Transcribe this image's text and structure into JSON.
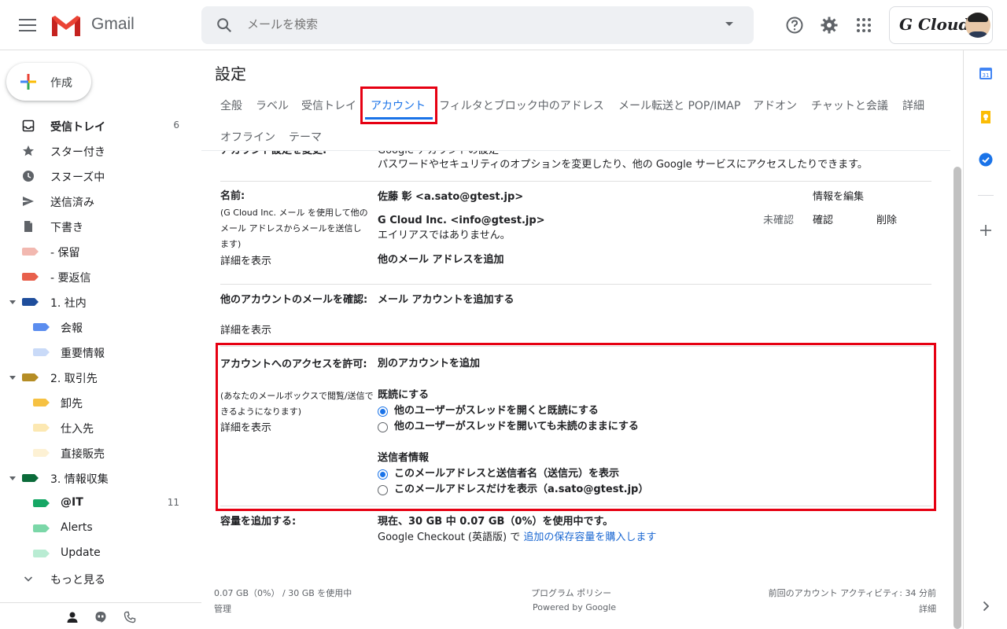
{
  "header": {
    "app_name": "Gmail",
    "search_placeholder": "メールを検索",
    "account_label": "G Cloud"
  },
  "sidebar": {
    "compose_label": "作成",
    "items": [
      {
        "label": "受信トレイ",
        "count": "6",
        "icon": "inbox-icon",
        "bold": true
      },
      {
        "label": "スター付き",
        "count": "",
        "icon": "star-icon"
      },
      {
        "label": "スヌーズ中",
        "count": "",
        "icon": "clock-icon"
      },
      {
        "label": "送信済み",
        "count": "",
        "icon": "send-icon"
      },
      {
        "label": "下書き",
        "count": "",
        "icon": "draft-icon"
      },
      {
        "label": "- 保留",
        "count": "",
        "icon": "label-icon",
        "color": "#f2b8b0"
      },
      {
        "label": "- 要返信",
        "count": "",
        "icon": "label-icon",
        "color": "#e8604c"
      },
      {
        "label": "1. 社内",
        "count": "",
        "icon": "label-icon",
        "color": "#1f4e9c"
      },
      {
        "label": "会報",
        "count": "",
        "icon": "label-icon",
        "color": "#5b8def"
      },
      {
        "label": "重要情報",
        "count": "",
        "icon": "label-icon",
        "color": "#c9daf8"
      },
      {
        "label": "2. 取引先",
        "count": "",
        "icon": "label-icon",
        "color": "#b58d25"
      },
      {
        "label": "卸先",
        "count": "",
        "icon": "label-icon",
        "color": "#f6c142"
      },
      {
        "label": "仕入先",
        "count": "",
        "icon": "label-icon",
        "color": "#fce8b2"
      },
      {
        "label": "直接販売",
        "count": "",
        "icon": "label-icon",
        "color": "#fdf1d4"
      },
      {
        "label": "3. 情報収集",
        "count": "",
        "icon": "label-icon",
        "color": "#0b6b3a"
      },
      {
        "label": "@IT",
        "count": "11",
        "icon": "label-icon",
        "color": "#16a765",
        "bold": true
      },
      {
        "label": "Alerts",
        "count": "",
        "icon": "label-icon",
        "color": "#7bd7a8"
      },
      {
        "label": "Update",
        "count": "",
        "icon": "label-icon",
        "color": "#b9ecd3"
      },
      {
        "label": "もっと見る",
        "count": "",
        "icon": "chevron-down-icon"
      }
    ]
  },
  "settings": {
    "title": "設定",
    "tabs_row1": [
      "全般",
      "ラベル",
      "受信トレイ",
      "アカウント",
      "フィルタとブロック中のアドレス",
      "メール転送と POP/IMAP",
      "アドオン",
      "チャットと会議",
      "詳細"
    ],
    "tabs_row2": [
      "オフライン",
      "テーマ"
    ],
    "active_tab": "アカウント",
    "clipped_top": {
      "label": "アカウント設定を変更:",
      "link": "Google アカウントの設定",
      "desc": "パスワードやセキュリティのオプションを変更したり、他の Google サービスにアクセスしたりできます。"
    },
    "name_section": {
      "label": "名前:",
      "note": "(G Cloud Inc. メール を使用して他のメール アドレスからメールを送信します)",
      "details_link": "詳細を表示",
      "primary": "佐藤 彰 <a.sato@gtest.jp>",
      "edit_link": "情報を編集",
      "alias": "G Cloud Inc. <info@gtest.jp>",
      "alias_status": "未確認",
      "confirm_link": "確認",
      "delete_link": "削除",
      "alias_note": "エイリアスではありません。",
      "add_link": "他のメール アドレスを追加"
    },
    "check_mail": {
      "label": "他のアカウントのメールを確認:",
      "details_link": "詳細を表示",
      "add_link": "メール アカウントを追加する"
    },
    "grant_access": {
      "label": "アカウントへのアクセスを許可:",
      "note": "(あなたのメールボックスで閲覧/送信できるようになります)",
      "details_link": "詳細を表示",
      "add_link": "別のアカウントを追加",
      "read_heading": "既読にする",
      "read_options": [
        "他のユーザーがスレッドを開くと既読にする",
        "他のユーザーがスレッドを開いても未読のままにする"
      ],
      "read_selected": 0,
      "sender_heading": "送信者情報",
      "sender_options": [
        "このメールアドレスと送信者名（送信元）を表示",
        "このメールアドレスだけを表示（a.sato@gtest.jp）"
      ],
      "sender_selected": 0
    },
    "storage": {
      "label": "容量を追加する:",
      "usage": "現在、30 GB 中 0.07 GB（0%）を使用中です。",
      "checkout_prefix": "Google Checkout (英語版) で ",
      "buy_link": "追加の保存容量を購入します"
    },
    "footer": {
      "usage": "0.07 GB（0%） / 30 GB を使用中",
      "manage": "管理",
      "policy": "プログラム ポリシー",
      "powered": "Powered by Google",
      "activity": "前回のアカウント アクティビティ: 34 分前",
      "details": "詳細"
    }
  },
  "colors": {
    "accent": "#1a73e8",
    "highlight_box": "#e60012"
  }
}
